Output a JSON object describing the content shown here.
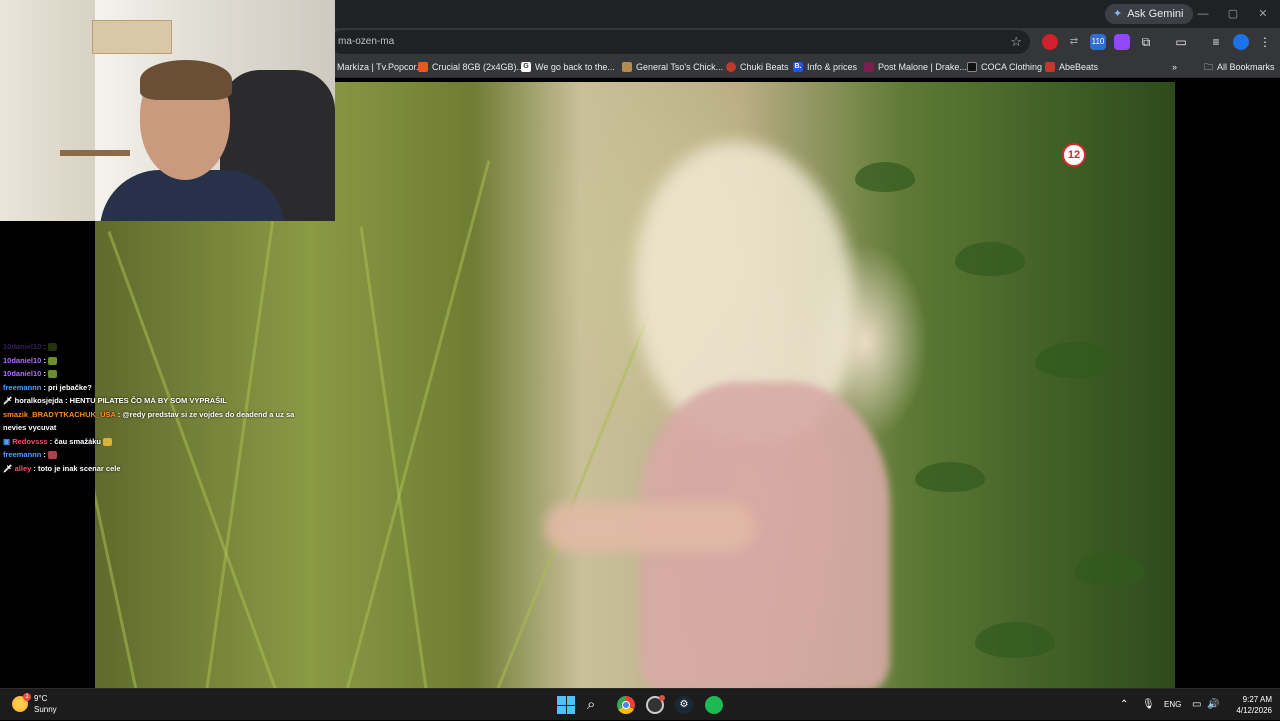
{
  "browser": {
    "ask_gemini": "Ask Gemini",
    "url": "ma-ozen-ma",
    "bookmarks": [
      {
        "label": "Markíza | Tv.Popcor...",
        "color": "#1f2f6b"
      },
      {
        "label": "Crucial 8GB (2x4GB)...",
        "color": "#e8581f"
      },
      {
        "label": "We go back to the...",
        "color": "#ffffff",
        "glyph": "G"
      },
      {
        "label": "General Tso's Chick...",
        "color": "#b58a4a"
      },
      {
        "label": "Chuki Beats",
        "color": "#c0392b"
      },
      {
        "label": "Info & prices",
        "color": "#1e5bd6",
        "glyph": "B."
      },
      {
        "label": "Post Malone | Drake...",
        "color": "#7a1d4f"
      },
      {
        "label": "COCA Clothing",
        "color": "#111111"
      },
      {
        "label": "AbeBeats",
        "color": "#c0392b"
      }
    ],
    "all_bookmarks": "All Bookmarks",
    "ext_badge": "110"
  },
  "video": {
    "channel_logo": "12"
  },
  "chat": [
    {
      "user": "10daniel10",
      "color": "#8a5cff",
      "message": "",
      "emote_color": "#6c8f2e",
      "faded": true
    },
    {
      "user": "10daniel10",
      "color": "#b06cff",
      "message": "",
      "emote_color": "#6c8f2e"
    },
    {
      "user": "10daniel10",
      "color": "#b06cff",
      "message": "",
      "emote_color": "#6c8f2e"
    },
    {
      "user": "freemannn",
      "color": "#4aa3ff",
      "message": "pri jebačke?"
    },
    {
      "user": "horalkosjejda",
      "color": "#ffffff",
      "message": "HENTU PILATES ČO MÁ BY SOM VYPRAŠIL",
      "badge": true
    },
    {
      "user": "smazik_BRADYTKACHUK_USA",
      "color": "#ff8c1a",
      "message": "@redy predstav si ze vojdes do deadend a uz sa nevies vycuvat",
      "mention": "@redy"
    },
    {
      "user": "Redovsss",
      "color": "#ff4d6d",
      "message": "čau smažáku",
      "emote_color": "#d8b43a",
      "badge": true
    },
    {
      "user": "freemannn",
      "color": "#4aa3ff",
      "message": "",
      "emote_color": "#b0414b"
    },
    {
      "user": "alley",
      "color": "#ff4d6d",
      "message": "toto je inak scenar cele",
      "badge": true
    }
  ],
  "taskbar": {
    "temperature": "9°C",
    "condition": "Sunny",
    "weather_alert": "1",
    "language": "ENG",
    "time": "9:27 AM",
    "date": "4/12/2026"
  }
}
